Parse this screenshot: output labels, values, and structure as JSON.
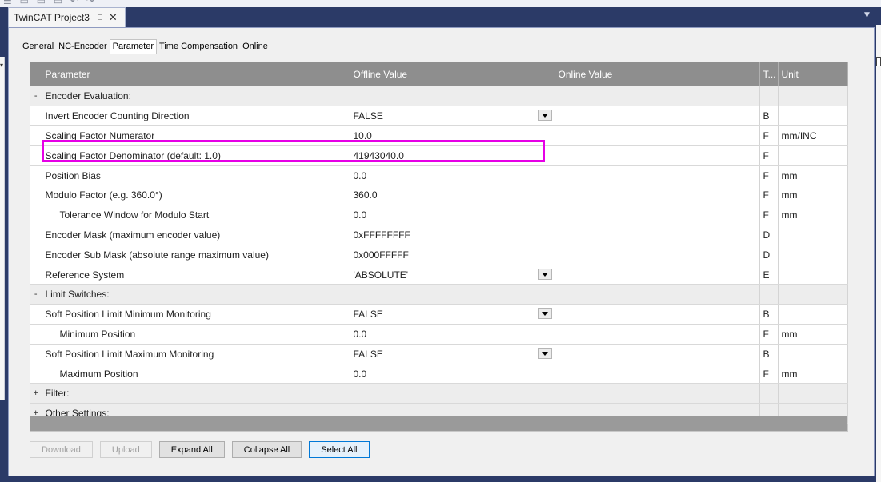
{
  "window": {
    "tab_title": "TwinCAT Project3",
    "pin_glyph": "⎕",
    "close_glyph": "✕"
  },
  "subtabs": [
    {
      "label": "General",
      "active": false
    },
    {
      "label": "NC-Encoder",
      "active": false
    },
    {
      "label": "Parameter",
      "active": true
    },
    {
      "label": "Time Compensation",
      "active": false
    },
    {
      "label": "Online",
      "active": false
    }
  ],
  "grid": {
    "columns": [
      "Parameter",
      "Offline Value",
      "Online Value",
      "T...",
      "Unit"
    ],
    "rows": [
      {
        "toggle": "-",
        "param": "Encoder Evaluation:",
        "offline": "",
        "online": "",
        "type": "",
        "unit": "",
        "section": true
      },
      {
        "toggle": "",
        "param": "Invert Encoder Counting Direction",
        "offline": "FALSE",
        "online": "",
        "type": "B",
        "unit": "",
        "dropdown": true
      },
      {
        "toggle": "",
        "param": "Scaling Factor Numerator",
        "offline": "10.0",
        "online": "",
        "type": "F",
        "unit": "mm/INC"
      },
      {
        "toggle": "",
        "param": "Scaling Factor Denominator (default: 1.0)",
        "offline": "41943040.0",
        "online": "",
        "type": "F",
        "unit": ""
      },
      {
        "toggle": "",
        "param": "Position Bias",
        "offline": "0.0",
        "online": "",
        "type": "F",
        "unit": "mm"
      },
      {
        "toggle": "",
        "param": "Modulo Factor (e.g. 360.0°)",
        "offline": "360.0",
        "online": "",
        "type": "F",
        "unit": "mm"
      },
      {
        "toggle": "",
        "param": "Tolerance Window for Modulo Start",
        "offline": "0.0",
        "online": "",
        "type": "F",
        "unit": "mm",
        "indent": true
      },
      {
        "toggle": "",
        "param": "Encoder Mask (maximum encoder value)",
        "offline": "0xFFFFFFFF",
        "online": "",
        "type": "D",
        "unit": ""
      },
      {
        "toggle": "",
        "param": "Encoder Sub Mask (absolute range maximum value)",
        "offline": "0x000FFFFF",
        "online": "",
        "type": "D",
        "unit": ""
      },
      {
        "toggle": "",
        "param": "Reference System",
        "offline": "'ABSOLUTE'",
        "online": "",
        "type": "E",
        "unit": "",
        "dropdown": true
      },
      {
        "toggle": "-",
        "param": "Limit Switches:",
        "offline": "",
        "online": "",
        "type": "",
        "unit": "",
        "section": true
      },
      {
        "toggle": "",
        "param": "Soft Position Limit Minimum Monitoring",
        "offline": "FALSE",
        "online": "",
        "type": "B",
        "unit": "",
        "dropdown": true
      },
      {
        "toggle": "",
        "param": "Minimum Position",
        "offline": "0.0",
        "online": "",
        "type": "F",
        "unit": "mm",
        "indent": true
      },
      {
        "toggle": "",
        "param": "Soft Position Limit Maximum Monitoring",
        "offline": "FALSE",
        "online": "",
        "type": "B",
        "unit": "",
        "dropdown": true
      },
      {
        "toggle": "",
        "param": "Maximum Position",
        "offline": "0.0",
        "online": "",
        "type": "F",
        "unit": "mm",
        "indent": true
      },
      {
        "toggle": "+",
        "param": "Filter:",
        "offline": "",
        "online": "",
        "type": "",
        "unit": "",
        "section": true
      },
      {
        "toggle": "+",
        "param": "Other Settings:",
        "offline": "",
        "online": "",
        "type": "",
        "unit": "",
        "section": true
      }
    ]
  },
  "buttons": {
    "download": "Download",
    "upload": "Upload",
    "expand_all": "Expand All",
    "collapse_all": "Collapse All",
    "select_all": "Select All"
  },
  "colors": {
    "highlight": "#e600e6",
    "header_bg": "#8e8e8e",
    "frame_bg": "#2b3a67"
  }
}
